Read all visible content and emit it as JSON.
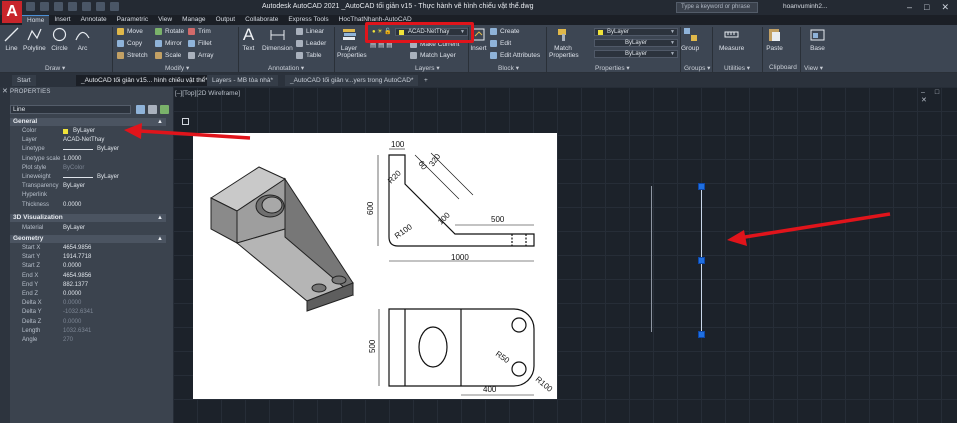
{
  "app": {
    "logo_letter": "A",
    "title": "Autodesk AutoCAD 2021    _AutoCAD tối giản v15 - Thực hành vẽ hình chiếu vật thể.dwg",
    "search_placeholder": "Type a keyword or phrase",
    "user": "hoanvuminh2...",
    "window_controls": [
      "–",
      "□",
      "✕"
    ]
  },
  "menu_tabs": [
    "Home",
    "Insert",
    "Annotate",
    "Parametric",
    "View",
    "Manage",
    "Output",
    "Collaborate",
    "Express Tools",
    "HocThatNhanh-AutoCAD"
  ],
  "ribbon": {
    "draw": {
      "label": "Draw ▾",
      "line": "Line",
      "polyline": "Polyline",
      "circle": "Circle",
      "arc": "Arc"
    },
    "modify": {
      "label": "Modify ▾",
      "move": "Move",
      "rotate": "Rotate",
      "trim": "Trim",
      "copy": "Copy",
      "mirror": "Mirror",
      "fillet": "Fillet",
      "stretch": "Stretch",
      "scale": "Scale",
      "array": "Array"
    },
    "annotation": {
      "label": "Annotation ▾",
      "text": "Text",
      "dimension": "Dimension",
      "linear": "Linear",
      "leader": "Leader",
      "table": "Table"
    },
    "layers": {
      "label": "Layers ▾",
      "layer_properties": "Layer Properties",
      "current_layer": "ACAD-NetThay",
      "make_current": "Make Current",
      "match_layer": "Match Layer"
    },
    "block": {
      "label": "Block ▾",
      "insert": "Insert",
      "create": "Create",
      "edit": "Edit",
      "edit_attributes": "Edit Attributes"
    },
    "properties": {
      "label": "Properties ▾",
      "match_properties": "Match Properties",
      "color": "ByLayer",
      "linetype": "ByLayer",
      "lineweight": "ByLayer"
    },
    "groups": {
      "label": "Groups ▾",
      "group": "Group"
    },
    "utilities": {
      "label": "Utilities ▾",
      "measure": "Measure"
    },
    "clipboard": {
      "label": "Clipboard",
      "paste": "Paste"
    },
    "view": {
      "label": "View ▾",
      "base": "Base"
    }
  },
  "doc_tabs": [
    "Start",
    "_AutoCAD tối giản v15... hình chiếu vật thể*",
    "Layers - MB tòa nhà*",
    "_AutoCAD tối giản v...yers trong AutoCAD*",
    "+"
  ],
  "properties_palette": {
    "title": "PROPERTIES",
    "selection": "Line",
    "general": {
      "header": "General",
      "rows": [
        {
          "label": "Color",
          "value": "ByLayer"
        },
        {
          "label": "Layer",
          "value": "ACAD-NetThay"
        },
        {
          "label": "Linetype",
          "value": "ByLayer"
        },
        {
          "label": "Linetype scale",
          "value": "1.0000"
        },
        {
          "label": "Plot style",
          "value": "ByColor"
        },
        {
          "label": "Lineweight",
          "value": "ByLayer"
        },
        {
          "label": "Transparency",
          "value": "ByLayer"
        },
        {
          "label": "Hyperlink",
          "value": ""
        },
        {
          "label": "Thickness",
          "value": "0.0000"
        }
      ]
    },
    "visualization": {
      "header": "3D Visualization",
      "rows": [
        {
          "label": "Material",
          "value": "ByLayer"
        }
      ]
    },
    "geometry": {
      "header": "Geometry",
      "rows": [
        {
          "label": "Start X",
          "value": "4654.9856"
        },
        {
          "label": "Start Y",
          "value": "1914.7718"
        },
        {
          "label": "Start Z",
          "value": "0.0000"
        },
        {
          "label": "End X",
          "value": "4654.9856"
        },
        {
          "label": "End Y",
          "value": "882.1377"
        },
        {
          "label": "End Z",
          "value": "0.0000"
        },
        {
          "label": "Delta X",
          "value": "0.0000"
        },
        {
          "label": "Delta Y",
          "value": "-1032.6341"
        },
        {
          "label": "Delta Z",
          "value": "0.0000"
        },
        {
          "label": "Length",
          "value": "1032.6341"
        },
        {
          "label": "Angle",
          "value": "270"
        }
      ]
    }
  },
  "viewport": {
    "label": "[–][Top][2D Wireframe]",
    "controls": "– □ ✕"
  },
  "drawing": {
    "dims": {
      "d100_top": "100",
      "d60": "60",
      "d320": "320",
      "r20": "R20",
      "d600": "600",
      "r100": "R100",
      "d100_slant": "100",
      "d500": "500",
      "d1000": "1000",
      "d500_left": "500",
      "r50": "R50",
      "r100_bottom": "R100",
      "d400": "400"
    }
  },
  "colors": {
    "accent_red": "#e0141b",
    "grip_blue": "#1f6fe0",
    "layer_yellow": "#f0e33a"
  }
}
